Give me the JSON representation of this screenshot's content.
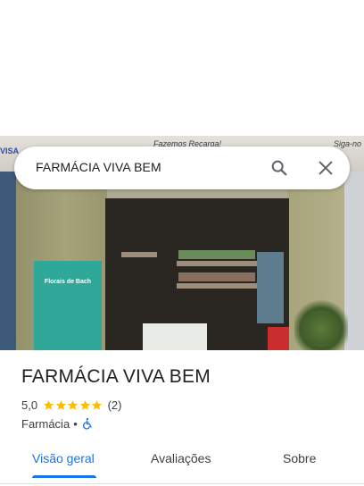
{
  "search": {
    "query": "FARMÁCIA VIVA BEM",
    "search_icon": "search-icon",
    "close_icon": "close-icon"
  },
  "photo": {
    "awning_text_center": "Fazemos Recarga!",
    "awning_text_right": "Siga-no",
    "card_text": "VISA",
    "banner_text": "Florais de Bach"
  },
  "place": {
    "title": "FARMÁCIA VIVA BEM",
    "rating": "5,0",
    "stars": 5,
    "review_count": "(2)",
    "category": "Farmácia",
    "separator": "•",
    "accessibility_icon": "wheelchair-icon"
  },
  "tabs": [
    {
      "label": "Visão geral",
      "active": true
    },
    {
      "label": "Avaliações",
      "active": false
    },
    {
      "label": "Sobre",
      "active": false
    }
  ],
  "colors": {
    "accent": "#1a73e8",
    "star": "#fbbc04",
    "text": "#202124",
    "secondary_text": "#3c4043"
  }
}
